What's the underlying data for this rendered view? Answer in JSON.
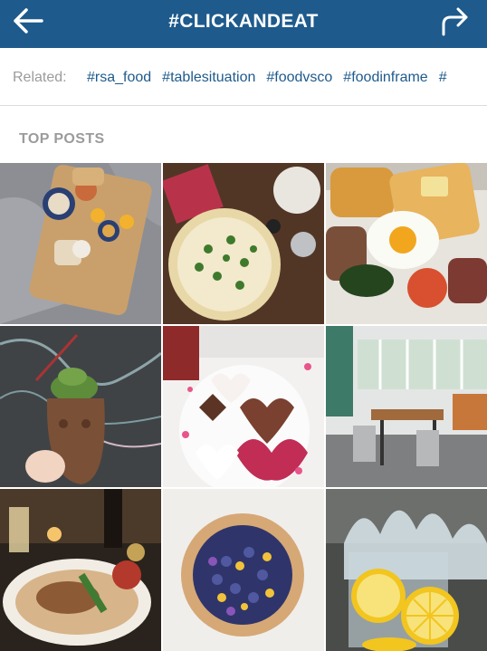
{
  "header": {
    "title": "#CLICKANDEAT",
    "back_icon": "arrow-left-icon",
    "share_icon": "share-arrow-icon",
    "bg_color": "#1e5a8c"
  },
  "related": {
    "label": "Related:",
    "tags": [
      "#rsa_food",
      "#tablesituation",
      "#foodvsco",
      "#foodinframe",
      "#"
    ],
    "tag_color": "#1e5a8c"
  },
  "section_title": "TOP POSTS",
  "posts": [
    {
      "subject": "breakfast-tray-on-blanket"
    },
    {
      "subject": "pizza-on-wooden-table"
    },
    {
      "subject": "full-english-breakfast"
    },
    {
      "subject": "taiyaki-ice-cream-cone"
    },
    {
      "subject": "heart-shaped-chocolates"
    },
    {
      "subject": "restaurant-interior"
    },
    {
      "subject": "plated-dinner-with-candles"
    },
    {
      "subject": "blueberry-tart"
    },
    {
      "subject": "lemon-splash"
    }
  ]
}
